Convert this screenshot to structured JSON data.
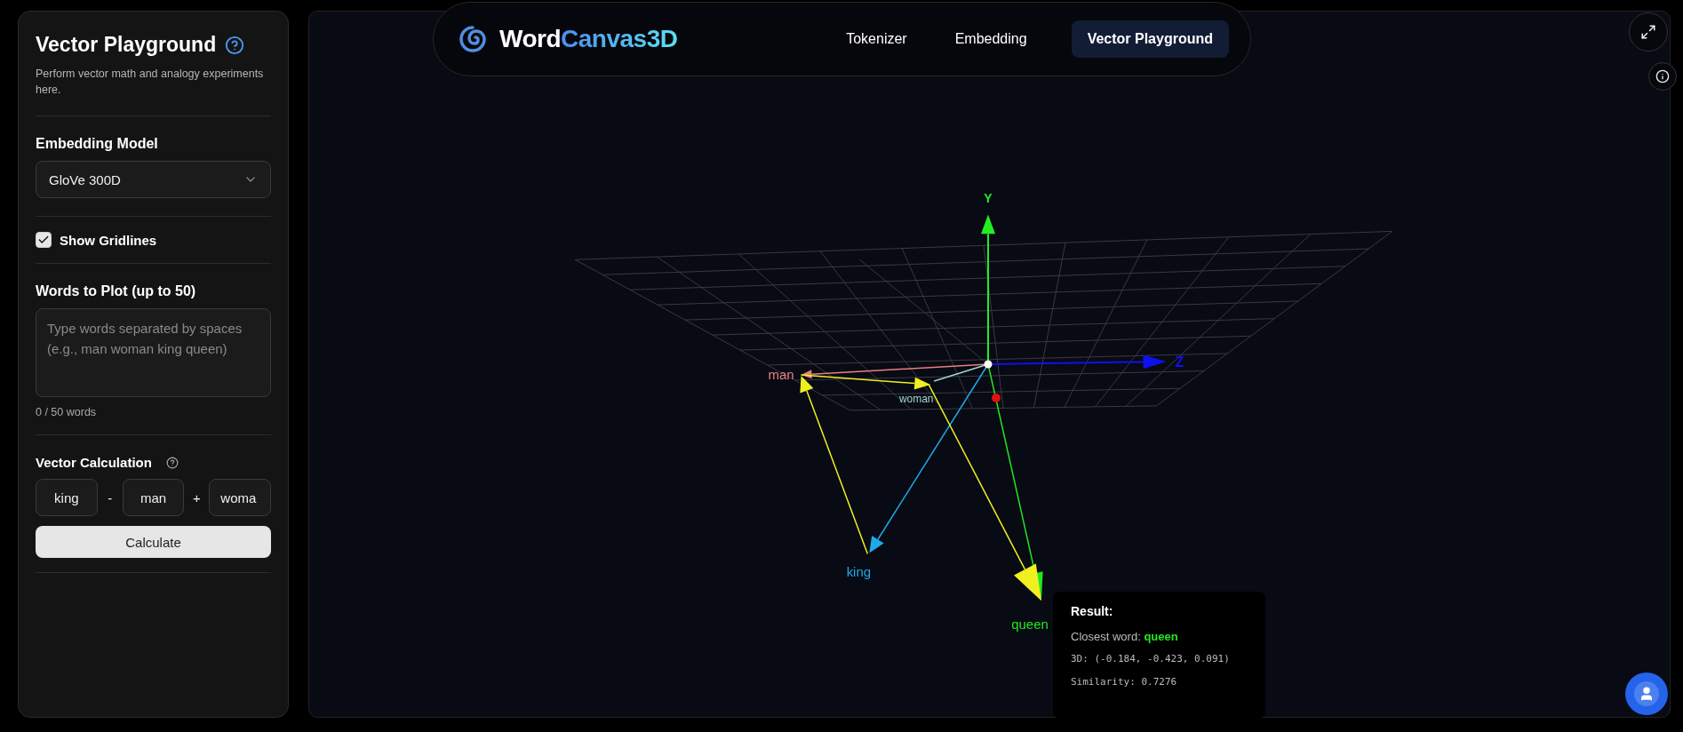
{
  "sidebar": {
    "title": "Vector Playground",
    "description": "Perform vector math and analogy experiments here.",
    "model": {
      "label": "Embedding Model",
      "value": "GloVe 300D"
    },
    "gridlines": {
      "label": "Show Gridlines",
      "checked": true
    },
    "words": {
      "label": "Words to Plot (up to 50)",
      "placeholder": "Type words separated by spaces (e.g., man woman king queen)",
      "count": "0 / 50 words"
    },
    "calculation": {
      "label": "Vector Calculation",
      "terms": [
        {
          "value": "king"
        },
        {
          "operator": "-",
          "value": "man"
        },
        {
          "operator": "+",
          "value": "woma"
        }
      ],
      "button": "Calculate"
    }
  },
  "header": {
    "logo_main": "Word",
    "logo_accent": "Canvas3D",
    "tabs": [
      {
        "label": "Tokenizer",
        "selected": false
      },
      {
        "label": "Embedding",
        "selected": false
      },
      {
        "label": "Vector Playground",
        "selected": true
      }
    ]
  },
  "scene": {
    "axes": [
      {
        "label": "Y",
        "color": "#22ee22"
      },
      {
        "label": "Z",
        "color": "#1010ee"
      }
    ],
    "words": [
      {
        "label": "man",
        "color": "#e88080"
      },
      {
        "label": "woman",
        "color": "#9fd8cc"
      },
      {
        "label": "king",
        "color": "#1eaae6"
      },
      {
        "label": "queen",
        "color": "#22e622"
      }
    ]
  },
  "result": {
    "title": "Result:",
    "closest_label": "Closest word:",
    "closest_word": "queen",
    "coords": "3D: (-0.184, -0.423, 0.091)",
    "similarity": "Similarity: 0.7276"
  }
}
